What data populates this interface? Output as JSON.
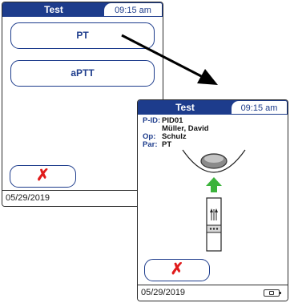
{
  "screen1": {
    "title": "Test",
    "time": "09:15 am",
    "buttons": {
      "pt": "PT",
      "aptt": "aPTT"
    },
    "cancel_label": "✗",
    "date": "05/29/2019"
  },
  "screen2": {
    "title": "Test",
    "time": "09:15 am",
    "info": [
      {
        "key": "P-ID:",
        "value": "PID01"
      },
      {
        "key": "",
        "value": "Müller, David"
      },
      {
        "key": "Op:",
        "value": "Schulz"
      },
      {
        "key": "Par:",
        "value": "PT"
      }
    ],
    "cancel_label": "✗",
    "date": "05/29/2019"
  },
  "colors": {
    "header_blue": "#1d3c8c",
    "cancel_red": "#e01b1b",
    "insert_arrow_green": "#3cb33c"
  },
  "icons": {
    "cancel": "x-icon",
    "battery": "battery-icon",
    "transition": "arrow-icon",
    "strip": "test-strip-icon",
    "insert": "up-arrow-icon"
  }
}
